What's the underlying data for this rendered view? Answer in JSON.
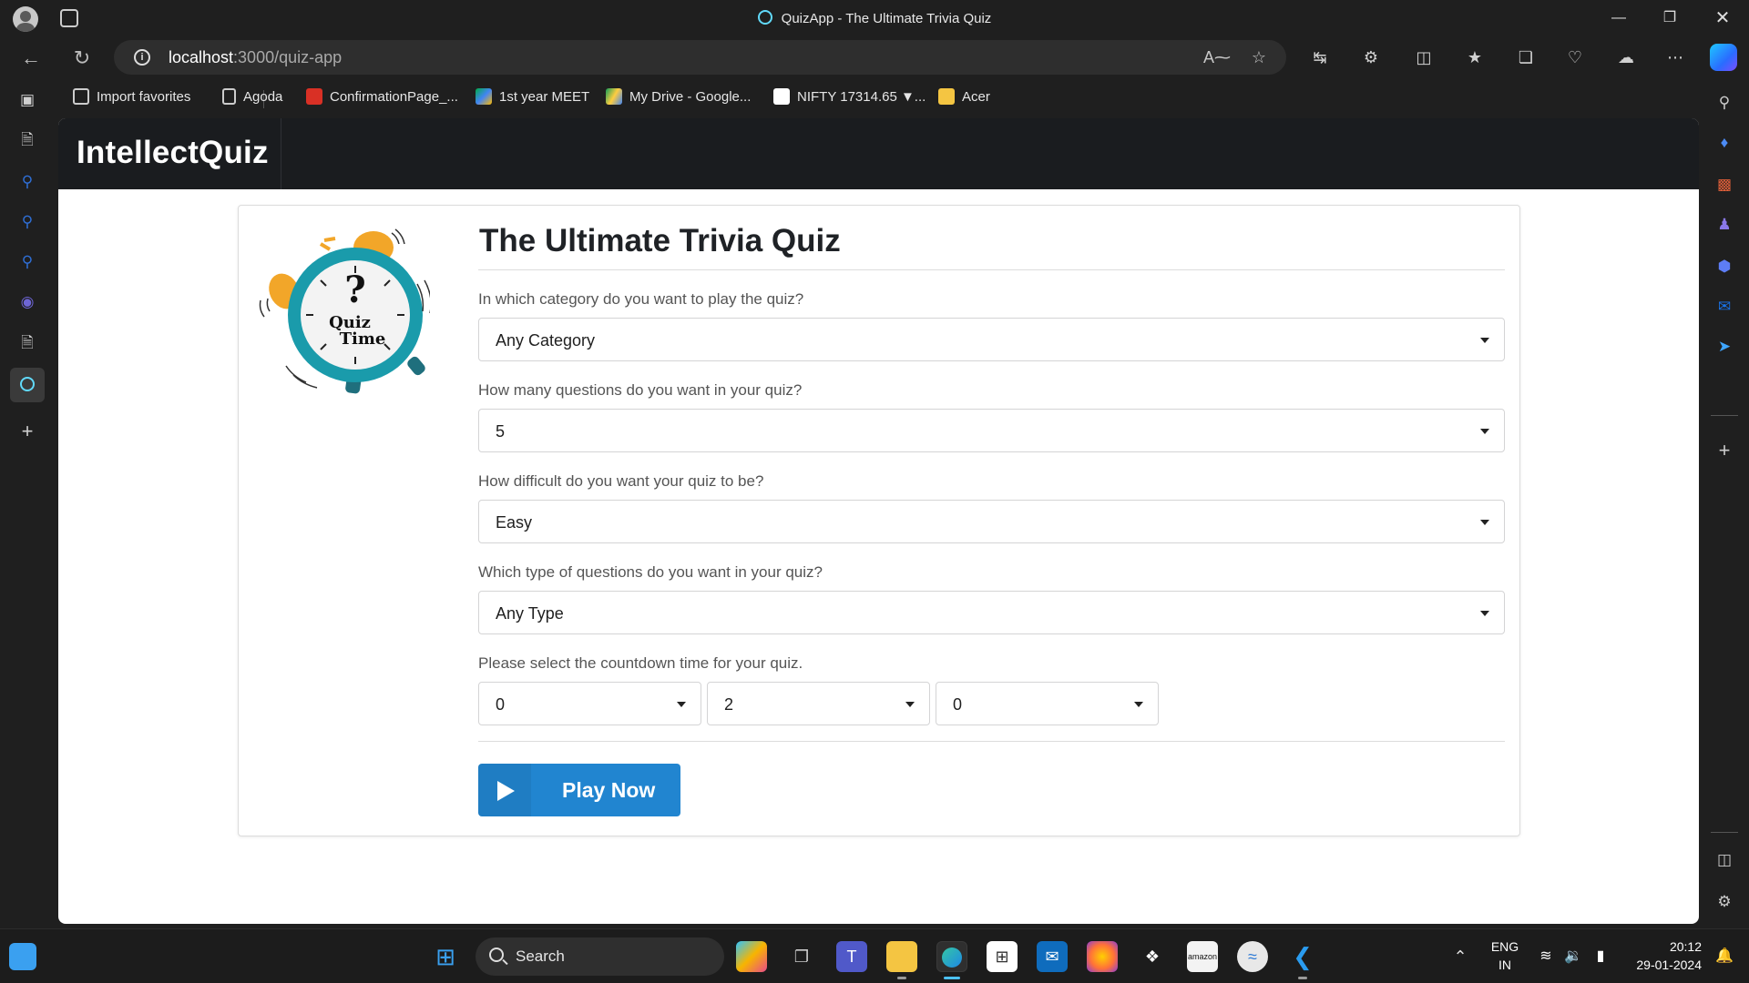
{
  "window": {
    "title": "QuizApp - The Ultimate Trivia Quiz"
  },
  "browser": {
    "url_host": "localhost",
    "url_path": ":3000/quiz-app",
    "bookmarks": [
      {
        "label": "Import favorites",
        "icon": "import-icon"
      },
      {
        "label": "Agoda",
        "icon": "page-icon"
      },
      {
        "label": "ConfirmationPage_...",
        "icon": "pdf-icon"
      },
      {
        "label": "1st year MEET",
        "icon": "meet-icon"
      },
      {
        "label": "My Drive - Google...",
        "icon": "drive-icon"
      },
      {
        "label": "NIFTY 17314.65 ▼...",
        "icon": "tradingview-icon"
      },
      {
        "label": "Acer",
        "icon": "folder-icon"
      }
    ]
  },
  "app": {
    "brand": "IntellectQuiz",
    "quiz_title": "The Ultimate Trivia Quiz",
    "questions": [
      {
        "label": "In which category do you want to play the quiz?",
        "value": "Any Category"
      },
      {
        "label": "How many questions do you want in your quiz?",
        "value": "5"
      },
      {
        "label": "How difficult do you want your quiz to be?",
        "value": "Easy"
      },
      {
        "label": "Which type of questions do you want in your quiz?",
        "value": "Any Type"
      }
    ],
    "timer": {
      "label": "Please select the countdown time for your quiz.",
      "hours": "0",
      "minutes": "2",
      "seconds": "0"
    },
    "play_button": "Play Now",
    "logo_text_1": "Quiz",
    "logo_text_2": "Time"
  },
  "taskbar": {
    "search_label": "Search",
    "lang_1": "ENG",
    "lang_2": "IN",
    "time": "20:12",
    "date": "29-01-2024"
  },
  "colors": {
    "accent": "#2185d0",
    "appbar": "#1a1c1f",
    "clock_teal": "#1a9bab",
    "bell_orange": "#f2a629"
  }
}
